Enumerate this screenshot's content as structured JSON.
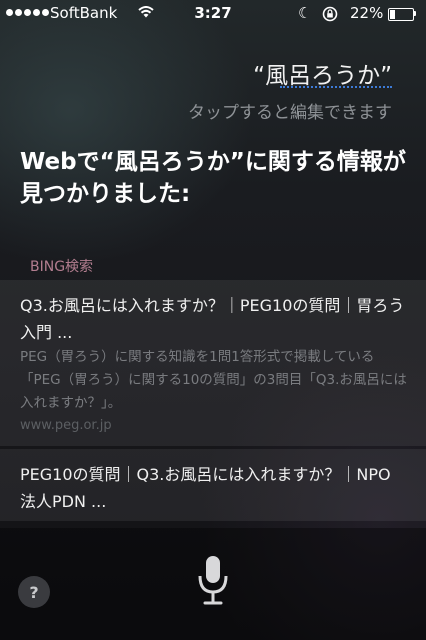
{
  "status_bar": {
    "carrier": "SoftBank",
    "time": "3:27",
    "battery_percent": "22%",
    "battery_level": 0.22
  },
  "siri": {
    "query": "“風呂ろうか”",
    "tap_hint": "タップすると編集できます",
    "headline": "Webで“風呂ろうか”に関する情報が見つかりました:",
    "section_label": "BING検索"
  },
  "results": [
    {
      "title": "Q3.お風呂には入れますか？｜PEG10の質問｜胃ろう入門 ...",
      "snippet": "PEG（胃ろう）に関する知識を1問1答形式で掲載している「PEG（胃ろう）に関する10の質問」の3問目「Q3.お風呂には入れますか？」。",
      "source": "www.peg.or.jp"
    },
    {
      "title": "PEG10の質問｜Q3.お風呂には入れますか？｜NPO法人PDN ..."
    }
  ],
  "bottom_bar": {
    "help_label": "?",
    "help_icon": "question-icon",
    "mic_icon": "microphone-icon"
  }
}
